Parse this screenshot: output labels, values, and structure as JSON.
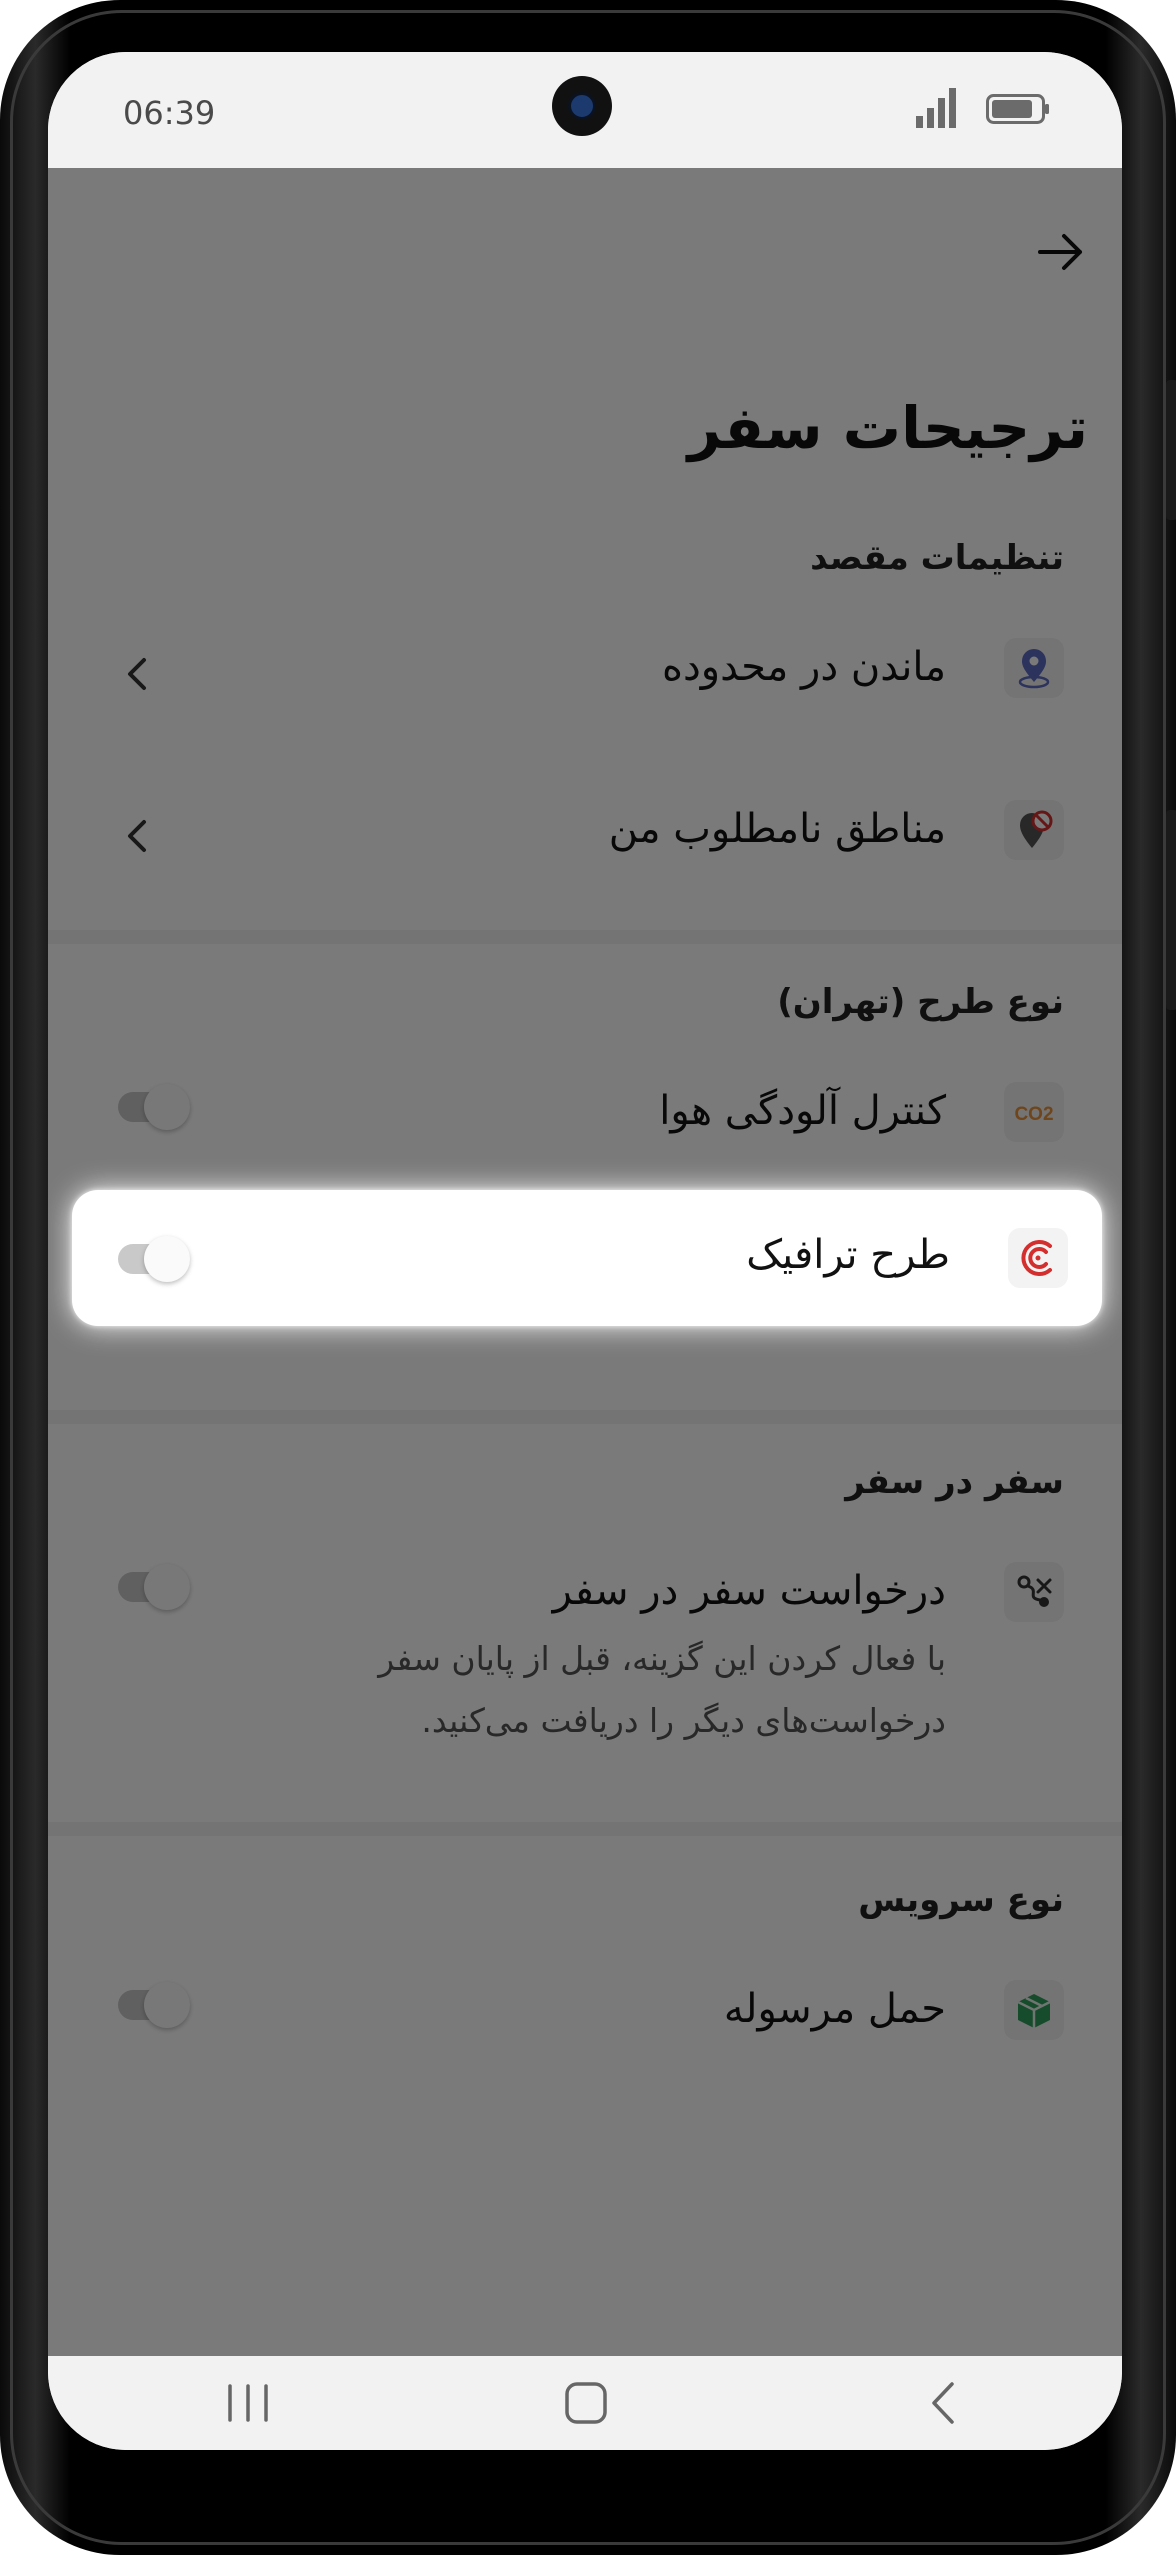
{
  "status_bar": {
    "time": "06:39"
  },
  "page": {
    "title": "ترجیحات سفر"
  },
  "sections": {
    "destination": {
      "header": "تنظیمات مقصد",
      "items": [
        {
          "label": "ماندن در محدوده",
          "icon": "location-pin-icon"
        },
        {
          "label": "مناطق نامطلوب من",
          "icon": "blocked-location-icon"
        }
      ]
    },
    "plan_type": {
      "header": "نوع طرح (تهران)",
      "items": [
        {
          "label": "کنترل آلودگی هوا",
          "icon": "co2-icon",
          "icon_text": "CO2",
          "enabled": false
        },
        {
          "label": "طرح ترافیک",
          "icon": "traffic-plan-icon",
          "enabled": false,
          "highlighted": true
        }
      ]
    },
    "in_trip": {
      "header": "سفر در سفر",
      "items": [
        {
          "label": "درخواست سفر در سفر",
          "description_line1": "با فعال کردن این گزینه، قبل از پایان سفر",
          "description_line2": "درخواست‌های دیگر را دریافت می‌کنید.",
          "icon": "route-icon",
          "enabled": false
        }
      ]
    },
    "service_type": {
      "header": "نوع سرویس",
      "items": [
        {
          "label": "حمل مرسوله",
          "icon": "package-icon",
          "enabled": false
        }
      ]
    }
  },
  "colors": {
    "co2_icon": "#e8913a",
    "traffic_icon": "#d32f2f",
    "package_icon": "#2e9e5b",
    "location_icon": "#5c6bc0"
  }
}
